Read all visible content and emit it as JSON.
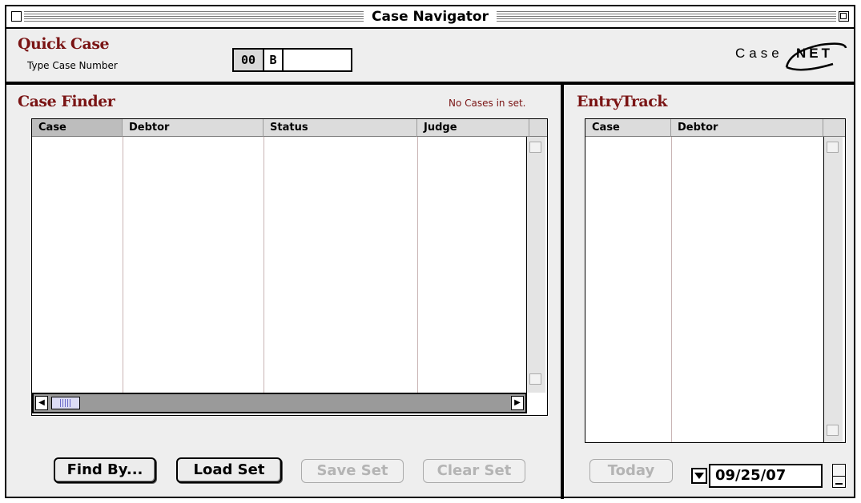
{
  "window": {
    "title": "Case Navigator"
  },
  "quick_case": {
    "title": "Quick Case",
    "subtitle": "Type Case Number",
    "year": "00",
    "type": "B",
    "number_value": ""
  },
  "logo": {
    "text": "CaseNET",
    "prefix": "Case",
    "suffix": "NET"
  },
  "case_finder": {
    "title": "Case Finder",
    "status_text": "No Cases in set.",
    "columns": [
      "Case",
      "Debtor",
      "Status",
      "Judge"
    ],
    "rows": []
  },
  "entry_track": {
    "title": "EntryTrack",
    "columns": [
      "Case",
      "Debtor"
    ],
    "rows": []
  },
  "buttons": {
    "find_by": "Find By...",
    "load_set": "Load Set",
    "save_set": "Save Set",
    "clear_set": "Clear Set",
    "today": "Today"
  },
  "date": {
    "value": "09/25/07"
  },
  "colors": {
    "accent": "#7a1414",
    "header_bg": "#dcdcdc",
    "window_bg": "#eeeeee"
  }
}
